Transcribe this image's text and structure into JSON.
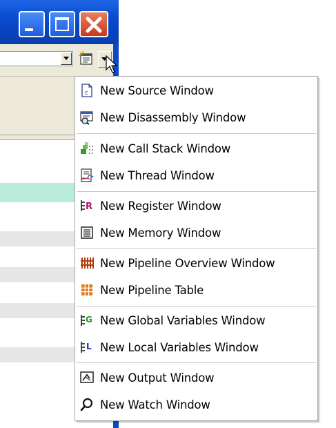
{
  "menu": {
    "items": [
      {
        "label": "New Source Window",
        "icon": "source-file-icon"
      },
      {
        "label": "New Disassembly Window",
        "icon": "disassembly-icon"
      },
      {
        "label": "New Call Stack Window",
        "icon": "call-stack-icon"
      },
      {
        "label": "New Thread Window",
        "icon": "thread-icon"
      },
      {
        "label": "New Register Window",
        "icon": "register-icon"
      },
      {
        "label": "New Memory Window",
        "icon": "memory-icon"
      },
      {
        "label": "New Pipeline Overview Window",
        "icon": "pipeline-overview-icon"
      },
      {
        "label": "New Pipeline Table",
        "icon": "pipeline-table-icon"
      },
      {
        "label": "New Global Variables Window",
        "icon": "global-variables-icon"
      },
      {
        "label": "New Local Variables Window",
        "icon": "local-variables-icon"
      },
      {
        "label": "New Output Window",
        "icon": "output-icon"
      },
      {
        "label": "New Watch Window",
        "icon": "watch-icon"
      }
    ]
  },
  "colors": {
    "titlebar": "#0a4fd0",
    "close_button": "#c8381b",
    "menu_border": "#a6a6a6",
    "highlight_row": "#b8ecd9",
    "stripe_row": "#e6e6e6"
  },
  "icons": {
    "icon_r_letter": "R",
    "icon_g_letter": "G",
    "icon_l_letter": "L",
    "icon_c_letter": "c"
  }
}
